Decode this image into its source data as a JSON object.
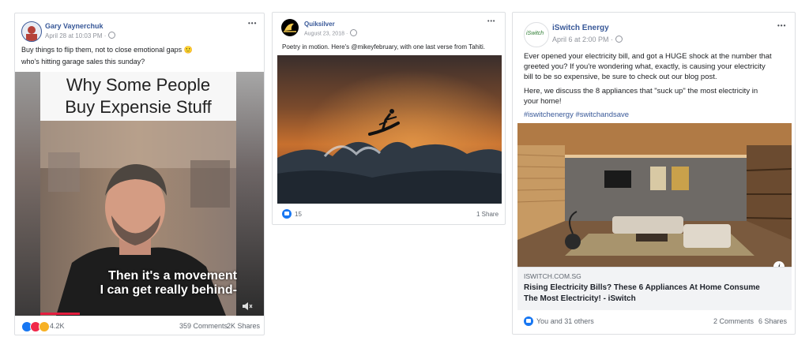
{
  "posts": [
    {
      "author": "Gary Vaynerchuk",
      "date": "April 28 at 10:03 PM",
      "more": "•••",
      "text_line1": "Buy things to flip them, not to close emotional gaps 🙂",
      "text_line2": "who's hitting garage sales this sunday?",
      "video_title_line1": "Why Some P",
      "video_title_mid": "eople",
      "video_title_line2": "Buy Expensi",
      "video_title_end": "e Stuff",
      "caption_line1": "Then it's a movement",
      "caption_line2": "I can get really behind-",
      "reactions": "4.2K",
      "comments": "359 Comments",
      "shares": "2K Shares"
    },
    {
      "author": "Quiksilver",
      "date": "August 23, 2018",
      "more": "•••",
      "text": "Poetry in motion. Here's @mikeyfebruary, with one last verse from Tahiti.",
      "reactions": "15",
      "shares": "1 Share"
    },
    {
      "author": "iSwitch Energy",
      "date": "April 6 at 2:00 PM",
      "more": "•••",
      "logo_text": "iSwitch",
      "para1_line1": "Ever opened your electricity bill, and got a HUGE shock at the number that",
      "para1_line2": "greeted you? If you're wondering what, exactly, is causing your electricity",
      "para1_line3": "bill to be so expensive, be sure to check out our blog post.",
      "para2_line1": "Here, we discuss the 8 appliances that \"suck up\" the most electricity in",
      "para2_line2": "your home!",
      "hashtags": "#iswitchenergy #switchandsave",
      "link_domain": "ISWITCH.COM.SG",
      "link_title_line1": "Rising Electricity Bills? These 6 Appliances At Home Consume",
      "link_title_line2": "The Most Electricity! - iSwitch",
      "info": "i",
      "reactions": "You and 31 others",
      "comments": "2 Comments",
      "shares": "6 Shares"
    }
  ],
  "colors": {
    "link": "#385898",
    "meta": "#90949c",
    "like": "#1877f2"
  }
}
